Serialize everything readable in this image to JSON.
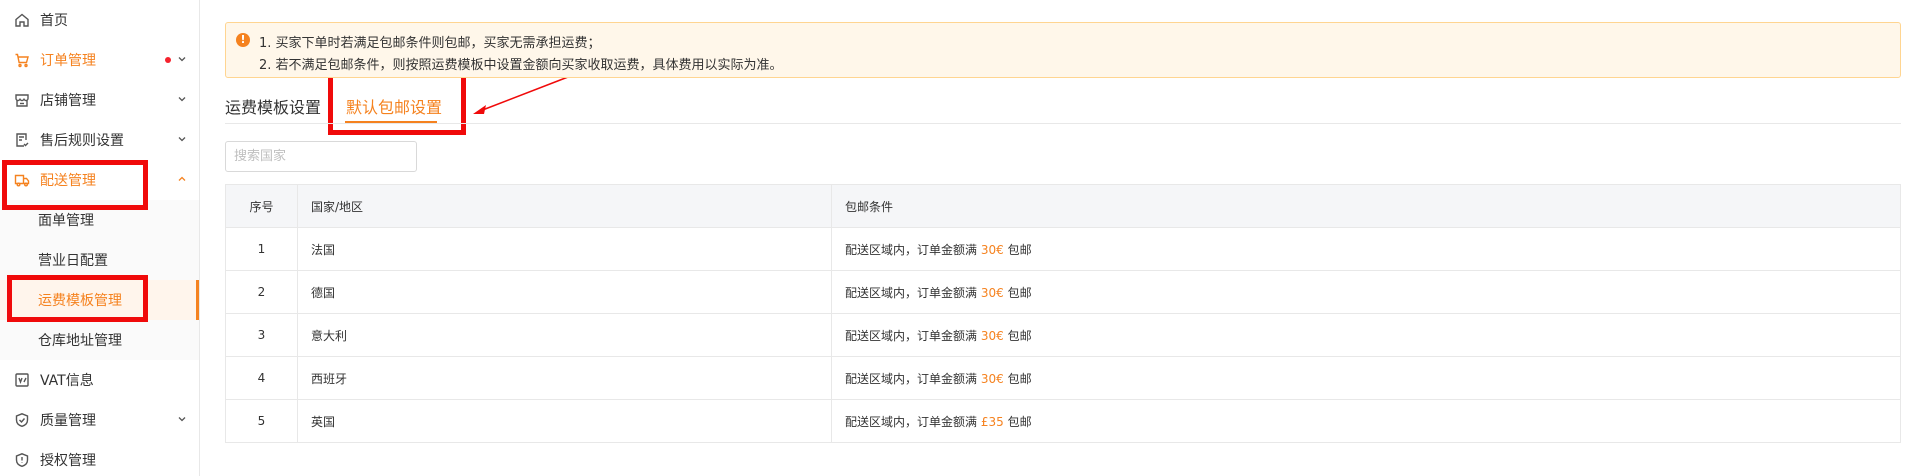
{
  "sidebar": {
    "items": [
      {
        "label": "首页",
        "icon": "home-icon"
      },
      {
        "label": "订单管理",
        "icon": "cart-icon"
      },
      {
        "label": "店铺管理",
        "icon": "shop-icon"
      },
      {
        "label": "售后规则设置",
        "icon": "rules-icon"
      },
      {
        "label": "配送管理",
        "icon": "truck-icon"
      },
      {
        "label": "VAT信息",
        "icon": "vat-icon"
      },
      {
        "label": "质量管理",
        "icon": "shield-icon"
      },
      {
        "label": "授权管理",
        "icon": "badge-icon"
      }
    ],
    "delivery_sub": [
      {
        "label": "面单管理"
      },
      {
        "label": "营业日配置"
      },
      {
        "label": "运费模板管理"
      },
      {
        "label": "仓库地址管理"
      }
    ]
  },
  "notice": {
    "line1": "1. 买家下单时若满足包邮条件则包邮，买家无需承担运费；",
    "line2": "2. 若不满足包邮条件，则按照运费模板中设置金额向买家收取运费，具体费用以实际为准。",
    "icon": "warning-icon"
  },
  "tabs": [
    {
      "label": "运费模板设置"
    },
    {
      "label": "默认包邮设置"
    }
  ],
  "search": {
    "placeholder": "搜索国家"
  },
  "table": {
    "headers": [
      "序号",
      "国家/地区",
      "包邮条件"
    ],
    "rows": [
      {
        "no": "1",
        "country": "法国",
        "cond_prefix": "配送区域内，订单金额满",
        "amount": "30€",
        "cond_suffix": "包邮"
      },
      {
        "no": "2",
        "country": "德国",
        "cond_prefix": "配送区域内，订单金额满",
        "amount": "30€",
        "cond_suffix": "包邮"
      },
      {
        "no": "3",
        "country": "意大利",
        "cond_prefix": "配送区域内，订单金额满",
        "amount": "30€",
        "cond_suffix": "包邮"
      },
      {
        "no": "4",
        "country": "西班牙",
        "cond_prefix": "配送区域内，订单金额满",
        "amount": "30€",
        "cond_suffix": "包邮"
      },
      {
        "no": "5",
        "country": "英国",
        "cond_prefix": "配送区域内，订单金额满",
        "amount": "£35",
        "cond_suffix": "包邮"
      }
    ]
  },
  "colors": {
    "accent": "#f5821f",
    "annotation": "#f00a0a",
    "dot": "#f5222d"
  }
}
